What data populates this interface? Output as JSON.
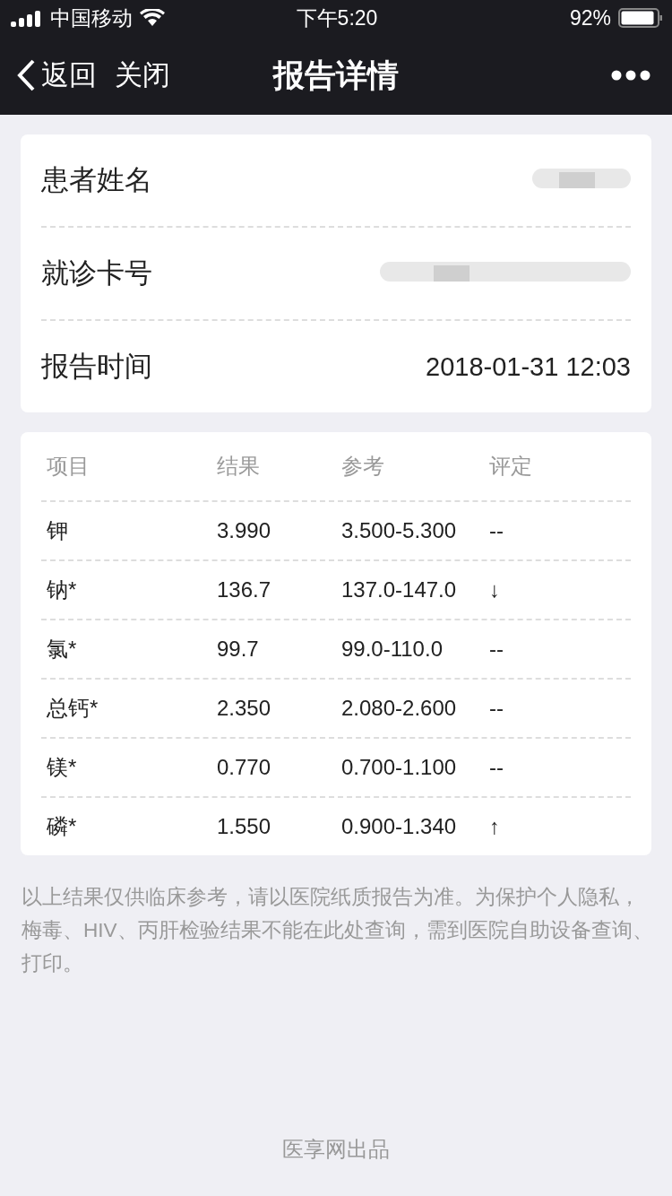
{
  "status_bar": {
    "carrier": "中国移动",
    "time": "下午5:20",
    "battery": "92%"
  },
  "nav": {
    "back": "返回",
    "close": "关闭",
    "title": "报告详情"
  },
  "info_rows": [
    {
      "label": "患者姓名",
      "kind": "redacted"
    },
    {
      "label": "就诊卡号",
      "kind": "redacted"
    },
    {
      "label": "报告时间",
      "kind": "text",
      "value": "2018-01-31 12:03"
    }
  ],
  "table": {
    "columns": [
      "项目",
      "结果",
      "参考",
      "评定"
    ],
    "rows": [
      [
        "钾",
        "3.990",
        "3.500-5.300",
        "--"
      ],
      [
        "钠*",
        "136.7",
        "137.0-147.0",
        "↓"
      ],
      [
        "氯*",
        "99.7",
        "99.0-110.0",
        "--"
      ],
      [
        "总钙*",
        "2.350",
        "2.080-2.600",
        "--"
      ],
      [
        "镁*",
        "0.770",
        "0.700-1.100",
        "--"
      ],
      [
        "磷*",
        "1.550",
        "0.900-1.340",
        "↑"
      ]
    ]
  },
  "note": "以上结果仅供临床参考，请以医院纸质报告为准。为保护个人隐私，梅毒、HIV、丙肝检验结果不能在此处查询，需到医院自助设备查询、打印。",
  "footer": "医享网出品"
}
